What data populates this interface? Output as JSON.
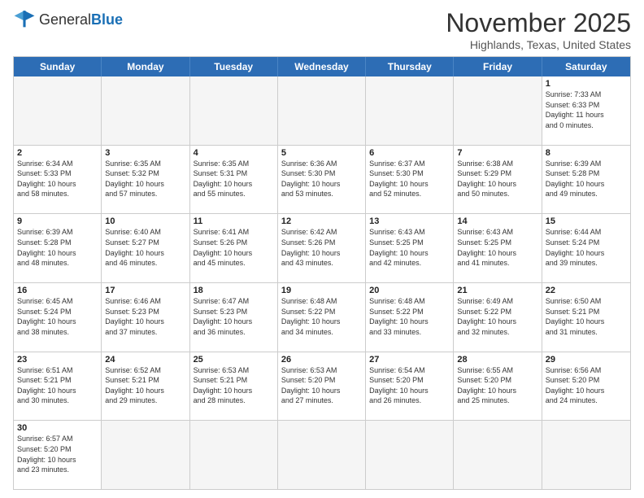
{
  "header": {
    "logo_general": "General",
    "logo_blue": "Blue",
    "title": "November 2025",
    "subtitle": "Highlands, Texas, United States"
  },
  "days_of_week": [
    "Sunday",
    "Monday",
    "Tuesday",
    "Wednesday",
    "Thursday",
    "Friday",
    "Saturday"
  ],
  "weeks": [
    [
      {
        "day": "",
        "info": "",
        "empty": true
      },
      {
        "day": "",
        "info": "",
        "empty": true
      },
      {
        "day": "",
        "info": "",
        "empty": true
      },
      {
        "day": "",
        "info": "",
        "empty": true
      },
      {
        "day": "",
        "info": "",
        "empty": true
      },
      {
        "day": "",
        "info": "",
        "empty": true
      },
      {
        "day": "1",
        "info": "Sunrise: 7:33 AM\nSunset: 6:33 PM\nDaylight: 11 hours\nand 0 minutes."
      }
    ],
    [
      {
        "day": "2",
        "info": "Sunrise: 6:34 AM\nSunset: 5:33 PM\nDaylight: 10 hours\nand 58 minutes."
      },
      {
        "day": "3",
        "info": "Sunrise: 6:35 AM\nSunset: 5:32 PM\nDaylight: 10 hours\nand 57 minutes."
      },
      {
        "day": "4",
        "info": "Sunrise: 6:35 AM\nSunset: 5:31 PM\nDaylight: 10 hours\nand 55 minutes."
      },
      {
        "day": "5",
        "info": "Sunrise: 6:36 AM\nSunset: 5:30 PM\nDaylight: 10 hours\nand 53 minutes."
      },
      {
        "day": "6",
        "info": "Sunrise: 6:37 AM\nSunset: 5:30 PM\nDaylight: 10 hours\nand 52 minutes."
      },
      {
        "day": "7",
        "info": "Sunrise: 6:38 AM\nSunset: 5:29 PM\nDaylight: 10 hours\nand 50 minutes."
      },
      {
        "day": "8",
        "info": "Sunrise: 6:39 AM\nSunset: 5:28 PM\nDaylight: 10 hours\nand 49 minutes."
      }
    ],
    [
      {
        "day": "9",
        "info": "Sunrise: 6:39 AM\nSunset: 5:28 PM\nDaylight: 10 hours\nand 48 minutes."
      },
      {
        "day": "10",
        "info": "Sunrise: 6:40 AM\nSunset: 5:27 PM\nDaylight: 10 hours\nand 46 minutes."
      },
      {
        "day": "11",
        "info": "Sunrise: 6:41 AM\nSunset: 5:26 PM\nDaylight: 10 hours\nand 45 minutes."
      },
      {
        "day": "12",
        "info": "Sunrise: 6:42 AM\nSunset: 5:26 PM\nDaylight: 10 hours\nand 43 minutes."
      },
      {
        "day": "13",
        "info": "Sunrise: 6:43 AM\nSunset: 5:25 PM\nDaylight: 10 hours\nand 42 minutes."
      },
      {
        "day": "14",
        "info": "Sunrise: 6:43 AM\nSunset: 5:25 PM\nDaylight: 10 hours\nand 41 minutes."
      },
      {
        "day": "15",
        "info": "Sunrise: 6:44 AM\nSunset: 5:24 PM\nDaylight: 10 hours\nand 39 minutes."
      }
    ],
    [
      {
        "day": "16",
        "info": "Sunrise: 6:45 AM\nSunset: 5:24 PM\nDaylight: 10 hours\nand 38 minutes."
      },
      {
        "day": "17",
        "info": "Sunrise: 6:46 AM\nSunset: 5:23 PM\nDaylight: 10 hours\nand 37 minutes."
      },
      {
        "day": "18",
        "info": "Sunrise: 6:47 AM\nSunset: 5:23 PM\nDaylight: 10 hours\nand 36 minutes."
      },
      {
        "day": "19",
        "info": "Sunrise: 6:48 AM\nSunset: 5:22 PM\nDaylight: 10 hours\nand 34 minutes."
      },
      {
        "day": "20",
        "info": "Sunrise: 6:48 AM\nSunset: 5:22 PM\nDaylight: 10 hours\nand 33 minutes."
      },
      {
        "day": "21",
        "info": "Sunrise: 6:49 AM\nSunset: 5:22 PM\nDaylight: 10 hours\nand 32 minutes."
      },
      {
        "day": "22",
        "info": "Sunrise: 6:50 AM\nSunset: 5:21 PM\nDaylight: 10 hours\nand 31 minutes."
      }
    ],
    [
      {
        "day": "23",
        "info": "Sunrise: 6:51 AM\nSunset: 5:21 PM\nDaylight: 10 hours\nand 30 minutes."
      },
      {
        "day": "24",
        "info": "Sunrise: 6:52 AM\nSunset: 5:21 PM\nDaylight: 10 hours\nand 29 minutes."
      },
      {
        "day": "25",
        "info": "Sunrise: 6:53 AM\nSunset: 5:21 PM\nDaylight: 10 hours\nand 28 minutes."
      },
      {
        "day": "26",
        "info": "Sunrise: 6:53 AM\nSunset: 5:20 PM\nDaylight: 10 hours\nand 27 minutes."
      },
      {
        "day": "27",
        "info": "Sunrise: 6:54 AM\nSunset: 5:20 PM\nDaylight: 10 hours\nand 26 minutes."
      },
      {
        "day": "28",
        "info": "Sunrise: 6:55 AM\nSunset: 5:20 PM\nDaylight: 10 hours\nand 25 minutes."
      },
      {
        "day": "29",
        "info": "Sunrise: 6:56 AM\nSunset: 5:20 PM\nDaylight: 10 hours\nand 24 minutes."
      }
    ],
    [
      {
        "day": "30",
        "info": "Sunrise: 6:57 AM\nSunset: 5:20 PM\nDaylight: 10 hours\nand 23 minutes."
      },
      {
        "day": "",
        "info": "",
        "empty": true
      },
      {
        "day": "",
        "info": "",
        "empty": true
      },
      {
        "day": "",
        "info": "",
        "empty": true
      },
      {
        "day": "",
        "info": "",
        "empty": true
      },
      {
        "day": "",
        "info": "",
        "empty": true
      },
      {
        "day": "",
        "info": "",
        "empty": true
      }
    ]
  ]
}
